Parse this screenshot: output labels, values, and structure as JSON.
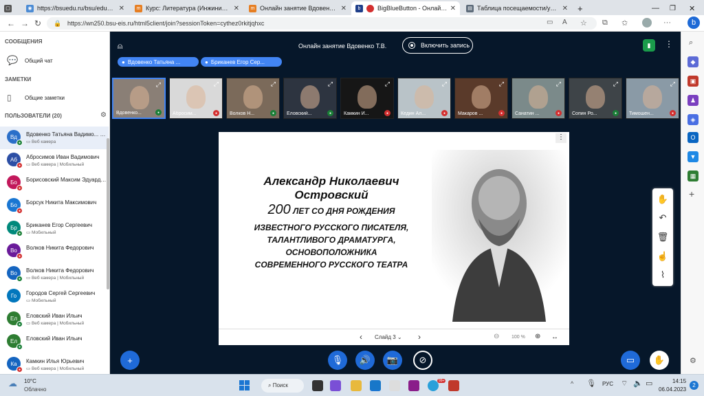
{
  "browser": {
    "tabs": [
      {
        "label": "https://bsuedu.ru/bsu/education"
      },
      {
        "label": "Курс: Литература (Инжиниринг"
      },
      {
        "label": "Онлайн занятие Вдовенко Т.В."
      },
      {
        "label": "BigBlueButton - Онлайн зан"
      },
      {
        "label": "Таблица посещаемости/успева"
      }
    ],
    "url": "https://wn250.bsu-eis.ru/html5client/join?sessionToken=cythez0rkitjqhxc"
  },
  "sidebar": {
    "messages_title": "СООБЩЕНИЯ",
    "public_chat": "Общий чат",
    "notes_title": "ЗАМЕТКИ",
    "shared_notes": "Общие заметки",
    "users_title": "ПОЛЬЗОВАТЕЛИ (20)",
    "users": [
      {
        "initials": "Вд",
        "name": "Вдовенко Татьяна Вадимо... (Вы)",
        "desc": "Веб камера",
        "color": "#2a6fc9",
        "mic": "#1a7f37"
      },
      {
        "initials": "Аб",
        "name": "Абросимов Иван Вадимович",
        "desc": "Веб камера | Мобильный",
        "color": "#2d4fa5",
        "mic": "#d32f2f"
      },
      {
        "initials": "Бо",
        "name": "Борисовский Максим Эдуардо...",
        "desc": "",
        "color": "#c2185b",
        "mic": "#d32f2f"
      },
      {
        "initials": "Бо",
        "name": "Борсук Никита Максимович",
        "desc": "",
        "color": "#1976d2",
        "mic": "#d32f2f"
      },
      {
        "initials": "Бр",
        "name": "Бриканев Егор Сергеевич",
        "desc": "Мобильный",
        "color": "#00897b",
        "mic": "#1a7f37"
      },
      {
        "initials": "Во",
        "name": "Волков Никита Федорович",
        "desc": "",
        "color": "#6a1b9a",
        "mic": "#d32f2f"
      },
      {
        "initials": "Во",
        "name": "Волков Никита Федорович",
        "desc": "Веб камера | Мобильный",
        "color": "#1565c0",
        "mic": "#1a7f37"
      },
      {
        "initials": "Го",
        "name": "Городов Сергей Сергеевич",
        "desc": "Мобильный",
        "color": "#0277bd",
        "mic": ""
      },
      {
        "initials": "Ел",
        "name": "Еловский Иван Ильич",
        "desc": "Веб камера | Мобильный",
        "color": "#2e7d32",
        "mic": "#1a7f37"
      },
      {
        "initials": "Ел",
        "name": "Еловский Иван Ильич",
        "desc": "",
        "color": "#2e7d32",
        "mic": "#1a7f37"
      },
      {
        "initials": "Ка",
        "name": "Камкин Илья Юрьевич",
        "desc": "Веб камера | Мобильный",
        "color": "#1565c0",
        "mic": "#d32f2f"
      }
    ]
  },
  "header": {
    "title": "Онлайн занятие Вдовенко Т.В.",
    "record_label": "Включить запись",
    "presenters": [
      "Вдовенко Татьяна ...",
      "Бриканев Егор Сер..."
    ]
  },
  "videos": [
    {
      "name": "Вдовенко...",
      "mic": "#1a7f37",
      "bg": "#8a7f76"
    },
    {
      "name": "Абросим...",
      "mic": "#d32f2f",
      "bg": "#d9d9d9"
    },
    {
      "name": "Волков Н...",
      "mic": "#1a7f37",
      "bg": "#7b6a5a"
    },
    {
      "name": "Еловский...",
      "mic": "#1a7f37",
      "bg": "#2d3440"
    },
    {
      "name": "Камкин И...",
      "mic": "#d32f2f",
      "bg": "#161616"
    },
    {
      "name": "Кедин Ал...",
      "mic": "#d32f2f",
      "bg": "#b9c3c8"
    },
    {
      "name": "Макаров ...",
      "mic": "#d32f2f",
      "bg": "#5a3a2a"
    },
    {
      "name": "Санатин ...",
      "mic": "#d32f2f",
      "bg": "#7b8a8a"
    },
    {
      "name": "Сопин Ро...",
      "mic": "#1a7f37",
      "bg": "#3e4448"
    },
    {
      "name": "Тимошен...",
      "mic": "#d32f2f",
      "bg": "#8a9aa6"
    }
  ],
  "slide": {
    "name_line1": "Александр Николаевич",
    "name_line2": "Островский",
    "anniv_number": "200",
    "anniv_text": "ЛЕТ СО ДНЯ РОЖДЕНИЯ",
    "desc": [
      "ИЗВЕСТНОГО РУССКОГО ПИСАТЕЛЯ,",
      "ТАЛАНТЛИВОГО ДРАМАТУРГА,",
      "ОСНОВОПОЛОЖНИКА",
      "СОВРЕМЕННОГО РУССКОГО ТЕАТРА"
    ],
    "slide_label": "Слайд 3",
    "zoom": "100 %"
  },
  "taskbar": {
    "weather_temp": "10°C",
    "weather_desc": "Облачно",
    "search": "Поиск",
    "lang": "РУС",
    "time": "14:15",
    "date": "06.04.2023",
    "badge": "99+",
    "notif": "2"
  }
}
